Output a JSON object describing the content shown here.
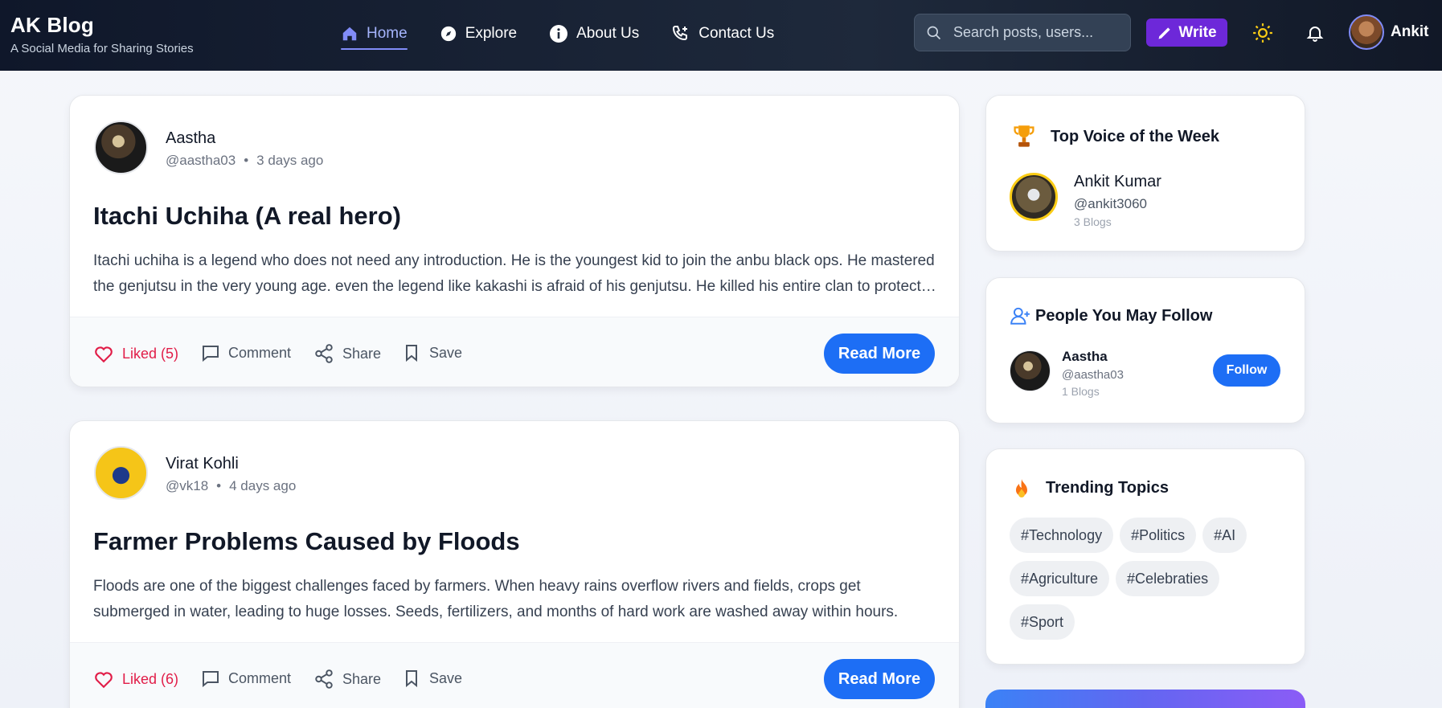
{
  "header": {
    "brand_title": "AK Blog",
    "brand_tagline": "A Social Media for Sharing Stories",
    "nav": [
      {
        "label": "Home",
        "icon": "home-icon",
        "active": true
      },
      {
        "label": "Explore",
        "icon": "compass-icon",
        "active": false
      },
      {
        "label": "About Us",
        "icon": "info-icon",
        "active": false
      },
      {
        "label": "Contact Us",
        "icon": "phone-plus-icon",
        "active": false
      }
    ],
    "search_placeholder": "Search posts, users...",
    "write_label": "Write",
    "user_name": "Ankit"
  },
  "posts": [
    {
      "author": "Aastha",
      "handle": "@aastha03",
      "time": "3 days ago",
      "title": "Itachi Uchiha (A real hero)",
      "excerpt": "Itachi uchiha is a legend who does not need any introduction. He is the youngest kid to join the anbu black ops. He mastered the genjutsu in the very young age. even the legend like kakashi is afraid of his genjutsu. He killed his entire clan to protect the village.",
      "liked_label": "Liked (5)",
      "comment_label": "Comment",
      "share_label": "Share",
      "save_label": "Save",
      "read_more": "Read More"
    },
    {
      "author": "Virat Kohli",
      "handle": "@vk18",
      "time": "4 days ago",
      "title": "Farmer Problems Caused by Floods",
      "excerpt": "Floods are one of the biggest challenges faced by farmers. When heavy rains overflow rivers and fields, crops get submerged in water, leading to huge losses. Seeds, fertilizers, and months of hard work are washed away within hours.",
      "liked_label": "Liked (6)",
      "comment_label": "Comment",
      "share_label": "Share",
      "save_label": "Save",
      "read_more": "Read More"
    }
  ],
  "sidebar": {
    "top_voice": {
      "title": "Top Voice of the Week",
      "name": "Ankit Kumar",
      "handle": "@ankit3060",
      "blogs": "3 Blogs"
    },
    "people": {
      "title": "People You May Follow",
      "name": "Aastha",
      "handle": "@aastha03",
      "blogs": "1 Blogs",
      "follow_label": "Follow"
    },
    "trending": {
      "title": "Trending Topics",
      "tags": [
        "#Technology",
        "#Politics",
        "#AI",
        "#Agriculture",
        "#Celebraties",
        "#Sport"
      ]
    }
  },
  "colors": {
    "header_bg": "#0f172a",
    "accent": "#1d6ef5",
    "write": "#6d28d9",
    "liked": "#e11d48"
  }
}
